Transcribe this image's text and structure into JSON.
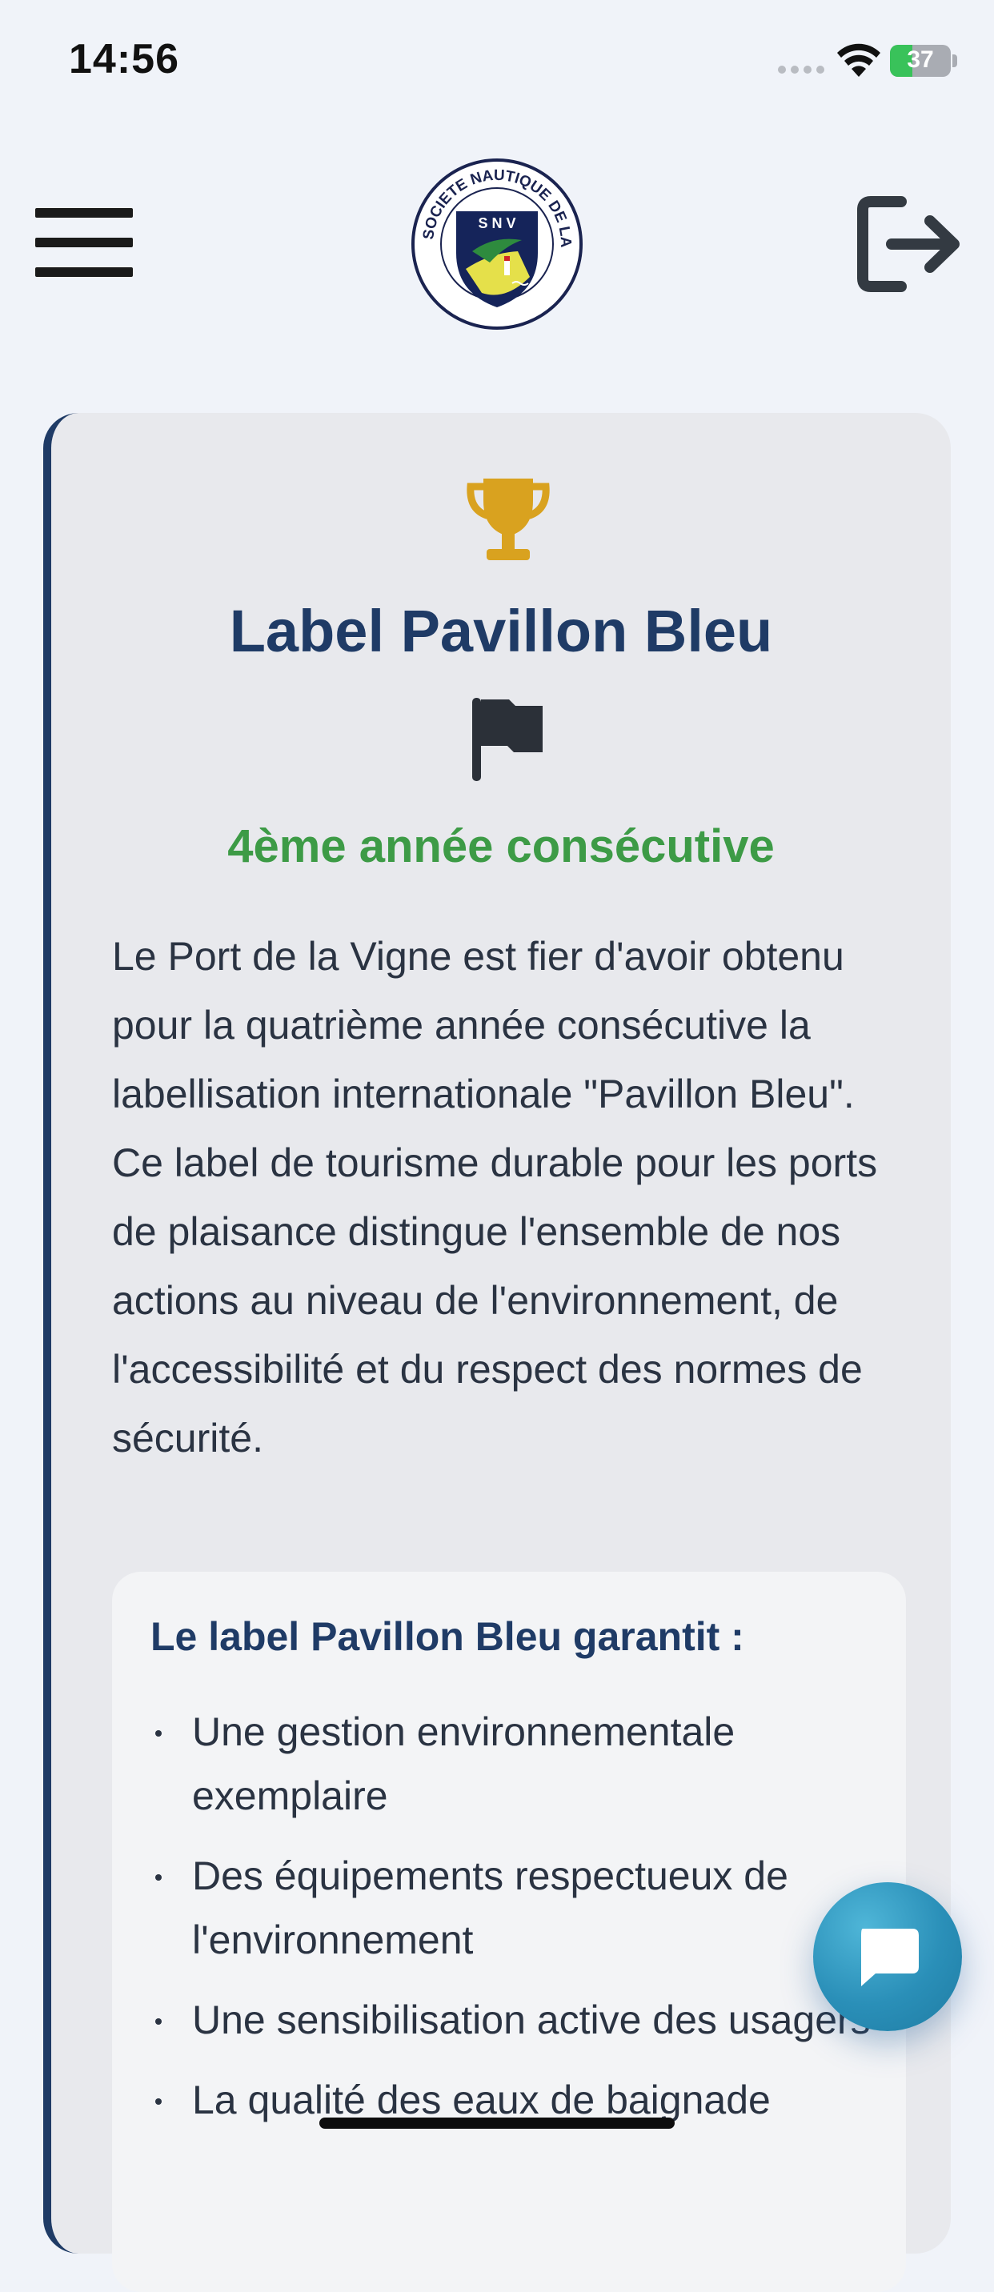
{
  "status_bar": {
    "time": "14:56",
    "battery_level": "37",
    "battery_fill_percent": 37,
    "icons": [
      "cellular-signal-icon",
      "wifi-icon",
      "battery-charging-icon"
    ]
  },
  "header": {
    "menu_icon": "hamburger-menu-icon",
    "logo": {
      "ring_text": "SOCIETE NAUTIQUE DE LA VIGNE",
      "initials": "S N V"
    },
    "logout_icon": "logout-icon"
  },
  "card": {
    "icon": "trophy-icon",
    "title": "Label Pavillon Bleu",
    "flag_icon": "flag-icon",
    "subtitle": "4ème année consécutive",
    "paragraph": "Le Port de la Vigne est fier d'avoir obtenu pour la quatrième année consécutive la labellisation internationale \"Pavillon Bleu\". Ce label de tourisme durable pour les ports de plaisance distingue l'ensemble de nos actions au niveau de l'environnement, de l'accessibilité et du respect des normes de sécurité.",
    "guarantee": {
      "title": "Le label Pavillon Bleu garantit :",
      "items": [
        "Une gestion environnementale exemplaire",
        "Des équipements respectueux de l'environnement",
        "Une sensibilisation active des usagers",
        "La qualité des eaux de baignade"
      ]
    }
  },
  "colors": {
    "accent_navy": "#1f3b66",
    "subtitle_green": "#3d9b46",
    "trophy_gold": "#d9a21f",
    "chat_blue": "#2a8fb8"
  },
  "chat_button_icon": "chat-bubble-icon"
}
